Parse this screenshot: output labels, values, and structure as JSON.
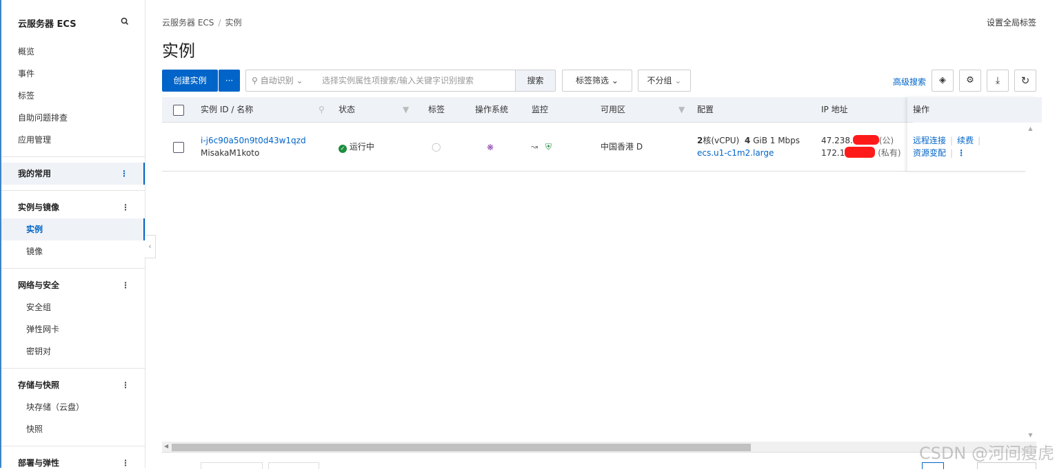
{
  "sidebar": {
    "title": "云服务器 ECS",
    "items": [
      "概览",
      "事件",
      "标签",
      "自助问题排查",
      "应用管理"
    ],
    "favorites": "我的常用",
    "groups": [
      {
        "label": "实例与镜像",
        "items": [
          "实例",
          "镜像"
        ]
      },
      {
        "label": "网络与安全",
        "items": [
          "安全组",
          "弹性网卡",
          "密钥对"
        ]
      },
      {
        "label": "存储与快照",
        "items": [
          "块存储（云盘）",
          "快照"
        ]
      },
      {
        "label": "部署与弹性",
        "items": []
      }
    ],
    "more_icon": "⋮"
  },
  "header": {
    "breadcrumb": [
      "云服务器 ECS",
      "实例"
    ],
    "breadcrumb_sep": "/",
    "title": "实例",
    "global_tags": "设置全局标签"
  },
  "toolbar": {
    "create": "创建实例",
    "more": "···",
    "search_mode": "自动识别",
    "search_placeholder": "选择实例属性项搜索/输入关键字识别搜索",
    "search_btn": "搜索",
    "tag_filter": "标签筛选",
    "group": "不分组",
    "advanced": "高级搜索"
  },
  "table": {
    "headers": [
      "实例 ID / 名称",
      "状态",
      "标签",
      "操作系统",
      "监控",
      "可用区",
      "配置",
      "IP 地址",
      "操作"
    ],
    "rows": [
      {
        "id": "i-j6c90a50n9t0d43w1qzd",
        "name": "MisakaM1koto",
        "status": "运行中",
        "zone": "中国香港 D",
        "cpu_num": "2",
        "cpu_unit": "核(vCPU)",
        "mem_num": "4",
        "mem_unit": "GiB 1 Mbps",
        "type": "ecs.u1-c1m2.large",
        "ip_public": "47.238.",
        "ip_public_tag": "(公)",
        "ip_private": "172.1",
        "ip_private_tag": "(私有)",
        "actions": [
          "远程连接",
          "续费",
          "资源变配"
        ]
      }
    ]
  },
  "watermark": "CSDN @河间瘦虎",
  "colors": {
    "brand": "#0064c8",
    "running": "#1e8e3e",
    "header_bg": "#eff2f7"
  }
}
